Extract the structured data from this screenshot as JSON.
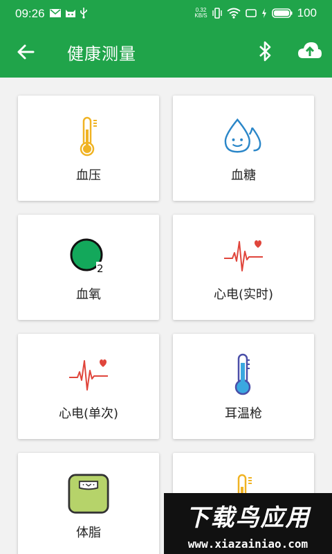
{
  "status_bar": {
    "time": "09:26",
    "net_speed_value": "0.32",
    "net_speed_unit": "KB/S",
    "battery": "100"
  },
  "app_bar": {
    "title": "健康测量",
    "back_icon": "arrow-back-icon",
    "bluetooth_icon": "bluetooth-icon",
    "upload_icon": "cloud-upload-icon"
  },
  "cards": [
    {
      "label": "血压",
      "icon": "thermometer-icon"
    },
    {
      "label": "血糖",
      "icon": "water-drops-icon"
    },
    {
      "label": "血氧",
      "icon": "o2-icon"
    },
    {
      "label": "心电(实时)",
      "icon": "ecg-heart-icon"
    },
    {
      "label": "心电(单次)",
      "icon": "ecg-heart-icon"
    },
    {
      "label": "耳温枪",
      "icon": "thermometer-icon"
    },
    {
      "label": "体脂",
      "icon": "scale-icon"
    },
    {
      "label": "",
      "icon": "thermometer-icon"
    }
  ],
  "watermark": {
    "title": "下载鸟应用",
    "url": "www.xiazainiao.com"
  },
  "colors": {
    "primary": "#20a44a",
    "thermo_yellow": "#f0b323",
    "drop_blue": "#2a86c8",
    "ecg_red": "#e0453b",
    "o2_green": "#13a85b",
    "ear_thermo_purple": "#4a4fa8",
    "scale_green": "#b6d36a"
  }
}
